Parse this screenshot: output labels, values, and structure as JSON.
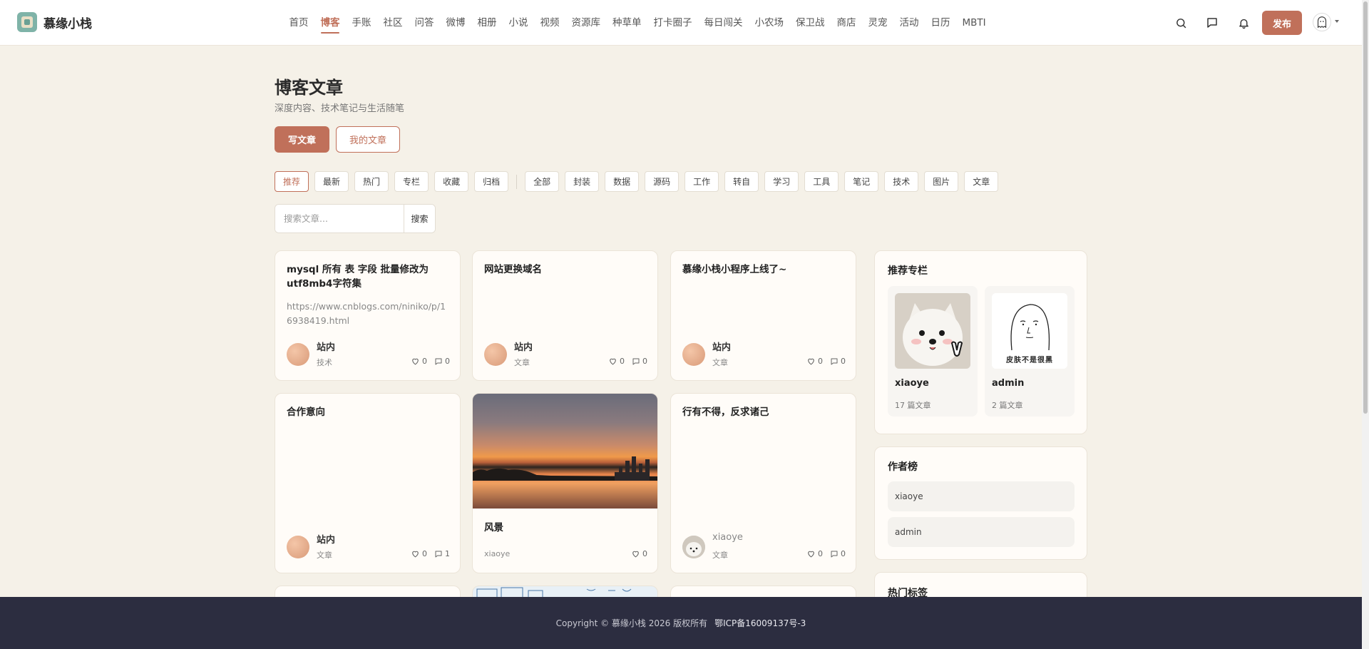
{
  "header": {
    "brand": "慕缘小栈",
    "nav": [
      "首页",
      "博客",
      "手账",
      "社区",
      "问答",
      "微博",
      "相册",
      "小说",
      "视频",
      "资源库",
      "种草单",
      "打卡圈子",
      "每日闯关",
      "小农场",
      "保卫战",
      "商店",
      "灵宠",
      "活动",
      "日历",
      "MBTI"
    ],
    "active_nav": "博客",
    "icons": [
      "search-icon",
      "message-icon",
      "bell-icon"
    ],
    "publish": "发布"
  },
  "page": {
    "title": "博客文章",
    "subtitle": "深度内容、技术笔记与生活随笔",
    "write_button": "写文章",
    "my_button": "我的文章"
  },
  "filters": {
    "sort": [
      "推荐",
      "最新",
      "热门",
      "专栏",
      "收藏",
      "归档"
    ],
    "active_sort": "推荐",
    "categories": [
      "全部",
      "封装",
      "数据",
      "源码",
      "工作",
      "转自",
      "学习",
      "工具",
      "笔记",
      "技术",
      "图片",
      "文章"
    ]
  },
  "search": {
    "placeholder": "搜索文章...",
    "button": "搜索"
  },
  "articles": [
    {
      "title": "mysql 所有 表 字段 批量修改为utf8mb4字符集",
      "excerpt": "https://www.cnblogs.com/niniko/p/16938419.html",
      "author": "站内",
      "category": "技术",
      "likes": "0",
      "comments": "0"
    },
    {
      "title": "网站更换域名",
      "author": "站内",
      "category": "文章",
      "likes": "0",
      "comments": "0"
    },
    {
      "title": "慕缘小栈小程序上线了~",
      "author": "站内",
      "category": "文章",
      "likes": "0",
      "comments": "0"
    },
    {
      "title": "合作意向",
      "author": "站内",
      "category": "文章",
      "likes": "0",
      "comments": "1"
    },
    {
      "title": "风景",
      "author": "xiaoye",
      "likes": "0"
    },
    {
      "title": "行有不得，反求诸己",
      "author": "xiaoye",
      "category": "文章",
      "likes": "0",
      "comments": "0"
    }
  ],
  "sidebar": {
    "columns_title": "推荐专栏",
    "columns": [
      {
        "name": "xiaoye",
        "count": "17 篇文章"
      },
      {
        "name": "admin",
        "count": "2 篇文章",
        "image_caption": "皮肤不是很黑"
      }
    ],
    "authors_title": "作者榜",
    "authors": [
      "xiaoye",
      "admin"
    ],
    "tags_title": "热门标签"
  },
  "footer": {
    "copyright": "Copyright © 慕缘小栈 2026 版权所有",
    "icp": "鄂ICP备16009137号-3"
  },
  "colors": {
    "accent": "#c0705a",
    "background": "#f5f1e8",
    "footer": "#2c2d40"
  }
}
